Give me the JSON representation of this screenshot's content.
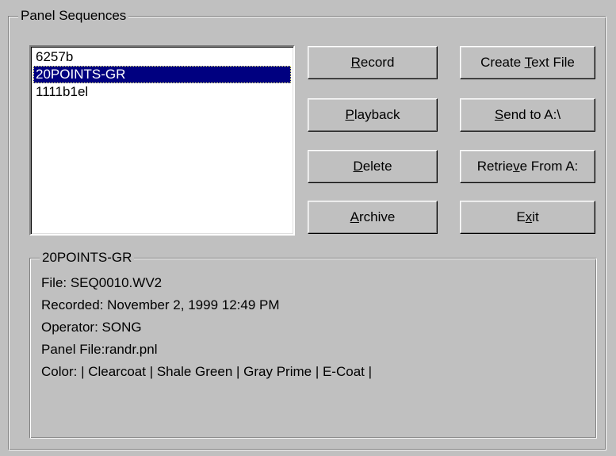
{
  "panel": {
    "title": "Panel Sequences"
  },
  "sequences": {
    "items": [
      "6257b",
      "20POINTS-GR",
      "1111b1el"
    ],
    "selected_index": 1
  },
  "buttons": {
    "record": {
      "pre": "",
      "key": "R",
      "post": "ecord"
    },
    "playback": {
      "pre": "",
      "key": "P",
      "post": "layback"
    },
    "delete": {
      "pre": "",
      "key": "D",
      "post": "elete"
    },
    "archive": {
      "pre": "",
      "key": "A",
      "post": "rchive"
    },
    "create_text_file": {
      "pre": "Create ",
      "key": "T",
      "post": "ext File"
    },
    "send_to_a": {
      "pre": "",
      "key": "S",
      "post": "end to A:\\"
    },
    "retrieve_from_a": {
      "pre": "Retrie",
      "key": "v",
      "post": "e From A:"
    },
    "exit": {
      "pre": "E",
      "key": "x",
      "post": "it"
    }
  },
  "details": {
    "title": "20POINTS-GR",
    "file": "File: SEQ0010.WV2",
    "recorded": "Recorded: November 2, 1999 12:49 PM",
    "operator": "Operator: SONG",
    "panel_file": "Panel File:randr.pnl",
    "color": "Color: | Clearcoat | Shale Green | Gray Prime | E-Coat |"
  },
  "colors": {
    "face": "#c0c0c0",
    "selection": "#000080",
    "selection_text": "#ffffff"
  }
}
